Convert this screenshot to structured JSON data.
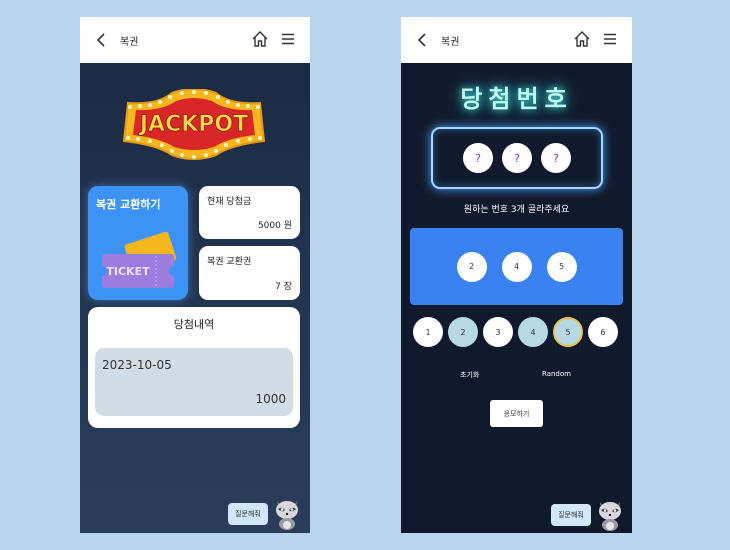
{
  "left_screen": {
    "header": {
      "title": "복권"
    },
    "jackpot_logo_text": "JACKPOT",
    "exchange_card": {
      "title": "복권 교환하기",
      "ticket_text": "TICKET"
    },
    "prize_card": {
      "label": "현재 당첨금",
      "value": "5000 원"
    },
    "tickets_card": {
      "label": "복권 교환권",
      "value": "7 장"
    },
    "history": {
      "title": "당첨내역",
      "items": [
        {
          "date": "2023-10-05",
          "amount": "1000"
        }
      ]
    },
    "help_button": "질문해줘"
  },
  "right_screen": {
    "header": {
      "title": "복권"
    },
    "winning_title": "당첨번호",
    "winning_numbers": [
      "?",
      "?",
      "?"
    ],
    "instruction": "원하는 번호 3개 골라주세요",
    "selected_numbers": [
      "2",
      "4",
      "5"
    ],
    "number_choices": [
      "1",
      "2",
      "3",
      "4",
      "5",
      "6"
    ],
    "reset_label": "초기화",
    "random_label": "Random",
    "submit_label": "응모하기",
    "help_button": "질문해줘"
  },
  "colors": {
    "accent_blue": "#3b82f1",
    "neon_cyan": "#bff8f0",
    "selected_ball": "#b7d9e4",
    "background": "#b9d5ee"
  }
}
